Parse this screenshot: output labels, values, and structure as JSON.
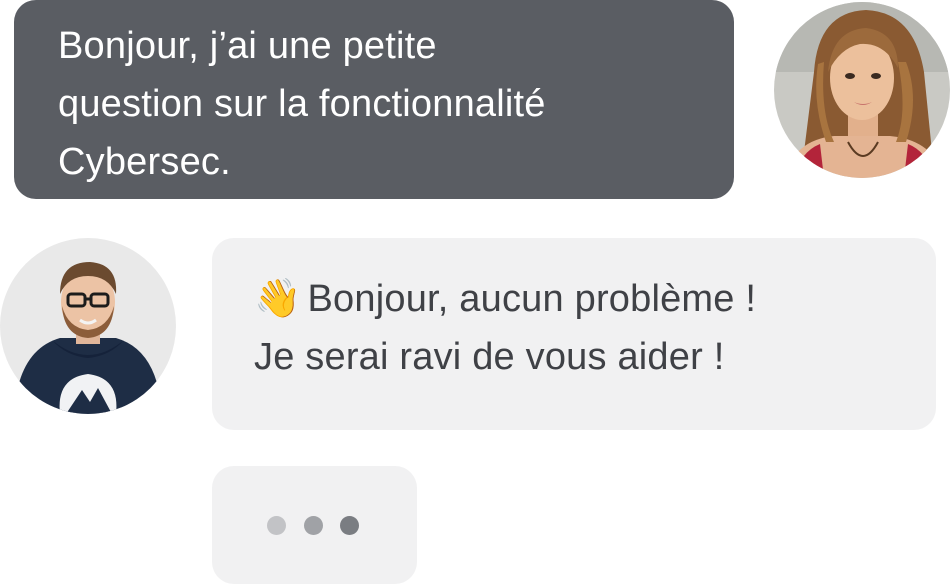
{
  "conversation": {
    "user_message": {
      "lines": [
        "Bonjour, j’ai une petite",
        "question sur la fonctionnalité",
        "Cybersec."
      ]
    },
    "agent_message": {
      "emoji": "👋",
      "lines": [
        "Bonjour, aucun problème !",
        "Je serai ravi de vous aider !"
      ]
    },
    "typing_indicator": {
      "dots": 3
    }
  },
  "colors": {
    "user_bubble": "#5a5d63",
    "agent_bubble": "#f1f1f2",
    "agent_text": "#3f4146"
  }
}
